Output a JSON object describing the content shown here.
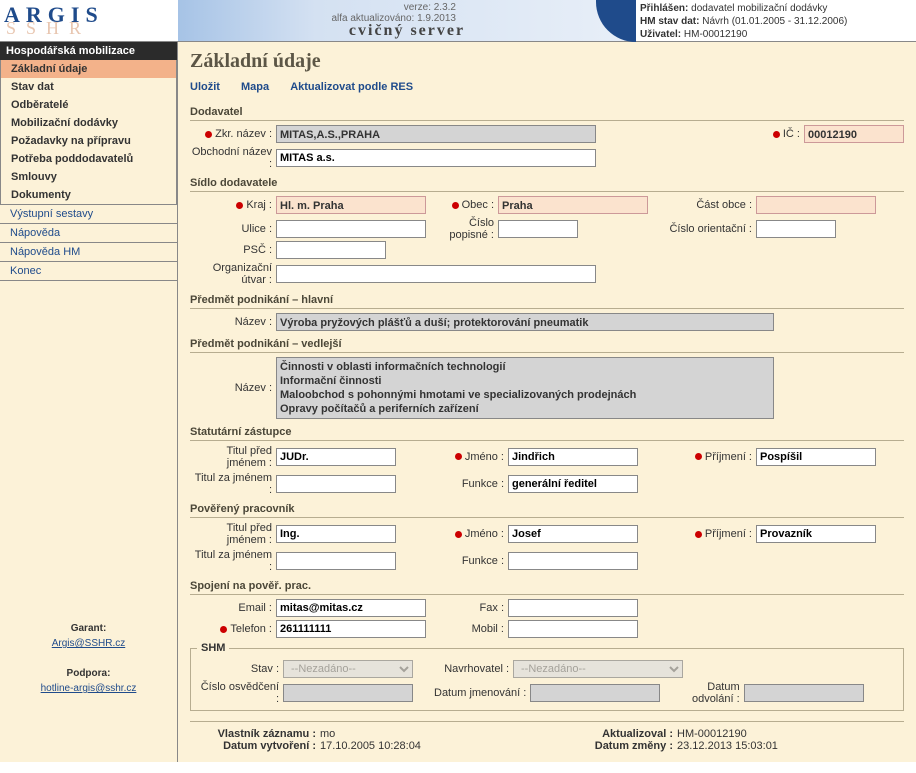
{
  "banner": {
    "logo1": "ARGIS",
    "logo2": "SSHR",
    "title": "cvičný server",
    "version_line1": "verze: 2.3.2",
    "version_line2": "alfa aktualizováno: 1.9.2013",
    "login_line1_l": "Přihlášen:",
    "login_line1_v": "dodavatel mobilizační dodávky",
    "login_line2_l": "HM stav dat:",
    "login_line2_v": "Návrh (01.01.2005 - 31.12.2006)",
    "login_line3_l": "Uživatel:",
    "login_line3_v": "HM-00012190"
  },
  "nav": {
    "head": "Hospodářská mobilizace",
    "items": [
      "Základní údaje",
      "Stav dat",
      "Odběratelé",
      "Mobilizační dodávky",
      "Požadavky na přípravu",
      "Potřeba poddodavatelů",
      "Smlouvy",
      "Dokumenty"
    ],
    "plain": [
      "Výstupní sestavy",
      "Nápověda",
      "Nápověda HM",
      "Konec"
    ],
    "garant_l": "Garant:",
    "garant_v": "Argis@SSHR.cz",
    "podpora_l": "Podpora:",
    "podpora_v": "hotline-argis@sshr.cz"
  },
  "page": {
    "title": "Základní údaje",
    "toolbar": {
      "save": "Uložit",
      "map": "Mapa",
      "refresh": "Aktualizovat podle RES"
    },
    "s_dodavatel": "Dodavatel",
    "zkr_nazev_l": "Zkr. název :",
    "zkr_nazev_v": "MITAS,A.S.,PRAHA",
    "ic_l": "IČ :",
    "ic_v": "00012190",
    "obch_nazev_l": "Obchodní název :",
    "obch_nazev_v": "MITAS a.s.",
    "s_sidlo": "Sídlo dodavatele",
    "kraj_l": "Kraj :",
    "kraj_v": "Hl. m. Praha",
    "obec_l": "Obec :",
    "obec_v": "Praha",
    "cast_l": "Část obce :",
    "cast_v": "",
    "ulice_l": "Ulice :",
    "ulice_v": "",
    "cpop_l": "Číslo popisné :",
    "cpop_v": "",
    "cori_l": "Číslo orientační :",
    "cori_v": "",
    "psc_l": "PSČ :",
    "psc_v": "",
    "org_l": "Organizační útvar :",
    "org_v": "",
    "s_predh": "Předmět podnikání – hlavní",
    "nazev_l": "Název :",
    "predh_v": "Výroba pryžových plášťů a duší; protektorování pneumatik",
    "s_predv": "Předmět podnikání – vedlejší",
    "predv_lines": "Činnosti v oblasti informačních technologií\nInformační činnosti\nMaloobchod s pohonnými hmotami ve specializovaných prodejnách\nOpravy počítačů a periferních zařízení",
    "s_stat": "Statutární zástupce",
    "tp_l": "Titul před jménem :",
    "tz_l": "Titul za jménem :",
    "jmeno_l": "Jméno :",
    "prijmeni_l": "Příjmení :",
    "funkce_l": "Funkce :",
    "stat_tp": "JUDr.",
    "stat_jm": "Jindřich",
    "stat_pr": "Pospíšil",
    "stat_tz": "",
    "stat_fn": "generální ředitel",
    "s_pov": "Pověřený pracovník",
    "pov_tp": "Ing.",
    "pov_jm": "Josef",
    "pov_pr": "Provazník",
    "pov_tz": "",
    "pov_fn": "",
    "s_spoj": "Spojení na pověř. prac.",
    "email_l": "Email :",
    "email_v": "mitas@mitas.cz",
    "fax_l": "Fax :",
    "fax_v": "",
    "tel_l": "Telefon :",
    "tel_v": "261111111",
    "mobil_l": "Mobil :",
    "mobil_v": "",
    "shm_title": "SHM",
    "stav_l": "Stav :",
    "stav_v": "--Nezadáno--",
    "navrh_l": "Navrhovatel :",
    "navrh_v": "--Nezadáno--",
    "cosv_l": "Číslo osvědčení :",
    "cosv_v": "",
    "djm_l": "Datum jmenování :",
    "djm_v": "",
    "dodv_l": "Datum odvolání :",
    "dodv_v": "",
    "foot_vlast_l": "Vlastník záznamu :",
    "foot_vlast_v": "mo",
    "foot_dvyt_l": "Datum vytvoření :",
    "foot_dvyt_v": "17.10.2005 10:28:04",
    "foot_akt_l": "Aktualizoval :",
    "foot_akt_v": "HM-00012190",
    "foot_dzm_l": "Datum změny :",
    "foot_dzm_v": "23.12.2013 15:03:01"
  }
}
